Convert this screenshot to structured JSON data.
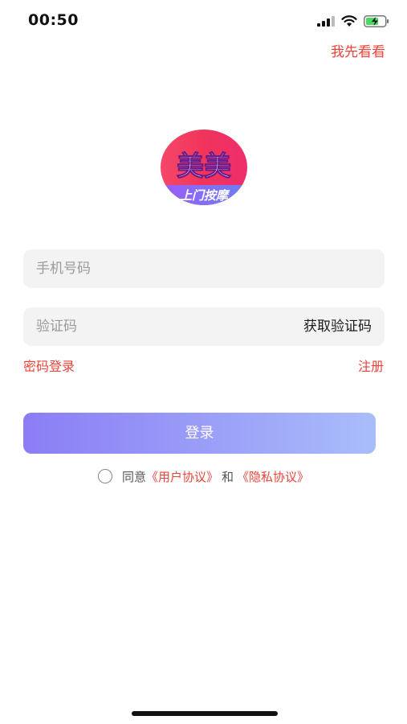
{
  "status_bar": {
    "time": "00:50",
    "icons": [
      "cellular-signal-icon",
      "wifi-icon",
      "battery-charging-icon"
    ]
  },
  "header": {
    "skip_label": "我先看看"
  },
  "logo": {
    "title": "美美",
    "subtitle": "上门按摩"
  },
  "form": {
    "phone_placeholder": "手机号码",
    "code_placeholder": "验证码",
    "get_code_label": "获取验证码"
  },
  "links": {
    "password_login": "密码登录",
    "register": "注册"
  },
  "login_button": "登录",
  "agreement": {
    "agree_text": "同意",
    "user_agreement": "《用户协议》",
    "and_text": "和",
    "privacy_policy": "《隐私协议》"
  },
  "colors": {
    "accent_red": "#e8453c",
    "button_gradient_start": "#8b7df5",
    "button_gradient_end": "#a9bdfa",
    "field_bg": "#f3f3f3"
  }
}
